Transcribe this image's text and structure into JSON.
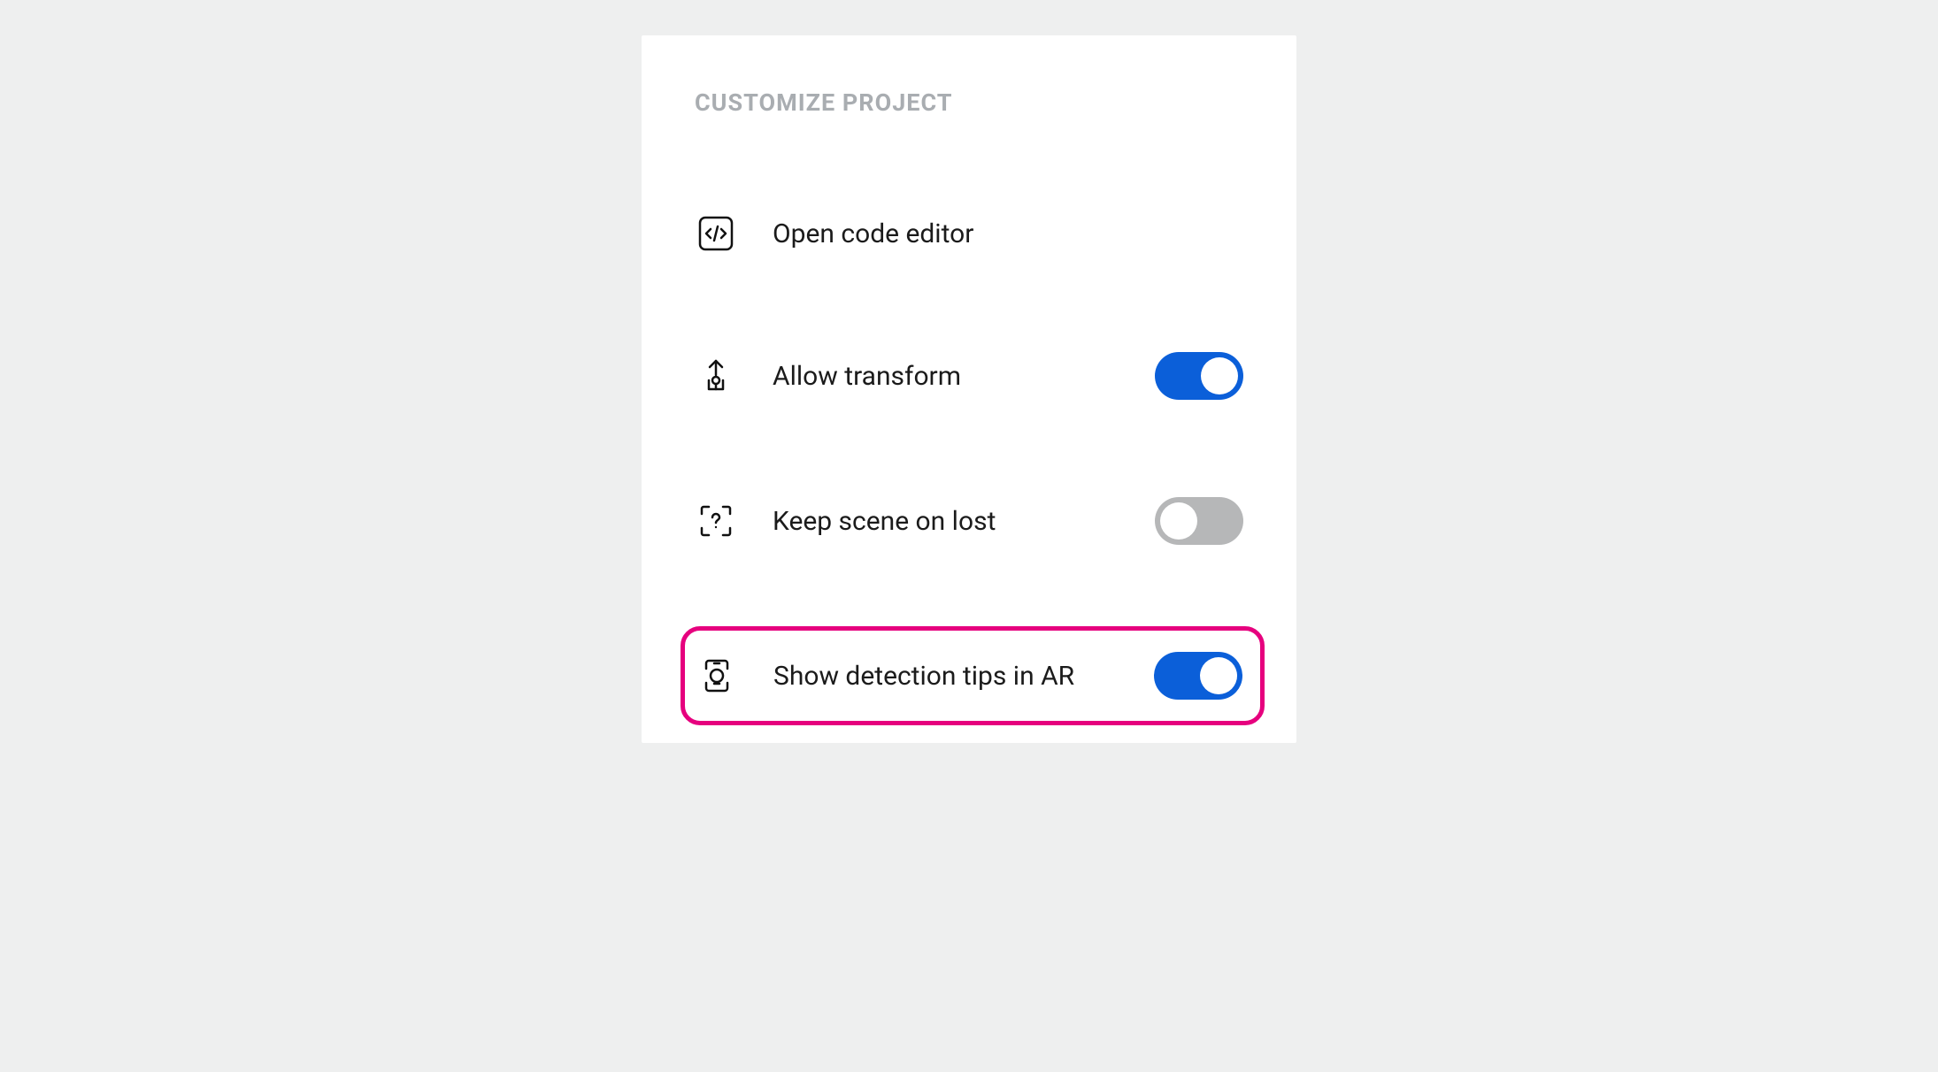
{
  "section": {
    "title": "CUSTOMIZE PROJECT"
  },
  "items": {
    "code_editor": {
      "label": "Open code editor"
    },
    "allow_transform": {
      "label": "Allow transform",
      "on": true
    },
    "keep_scene": {
      "label": "Keep scene on lost",
      "on": false
    },
    "detection_tips": {
      "label": "Show detection tips in AR",
      "on": true,
      "highlighted": true
    }
  },
  "colors": {
    "accent": "#0b5fd9",
    "highlight": "#e6007e",
    "toggle_off": "#b6b7b8",
    "title_muted": "#a9adb1"
  }
}
